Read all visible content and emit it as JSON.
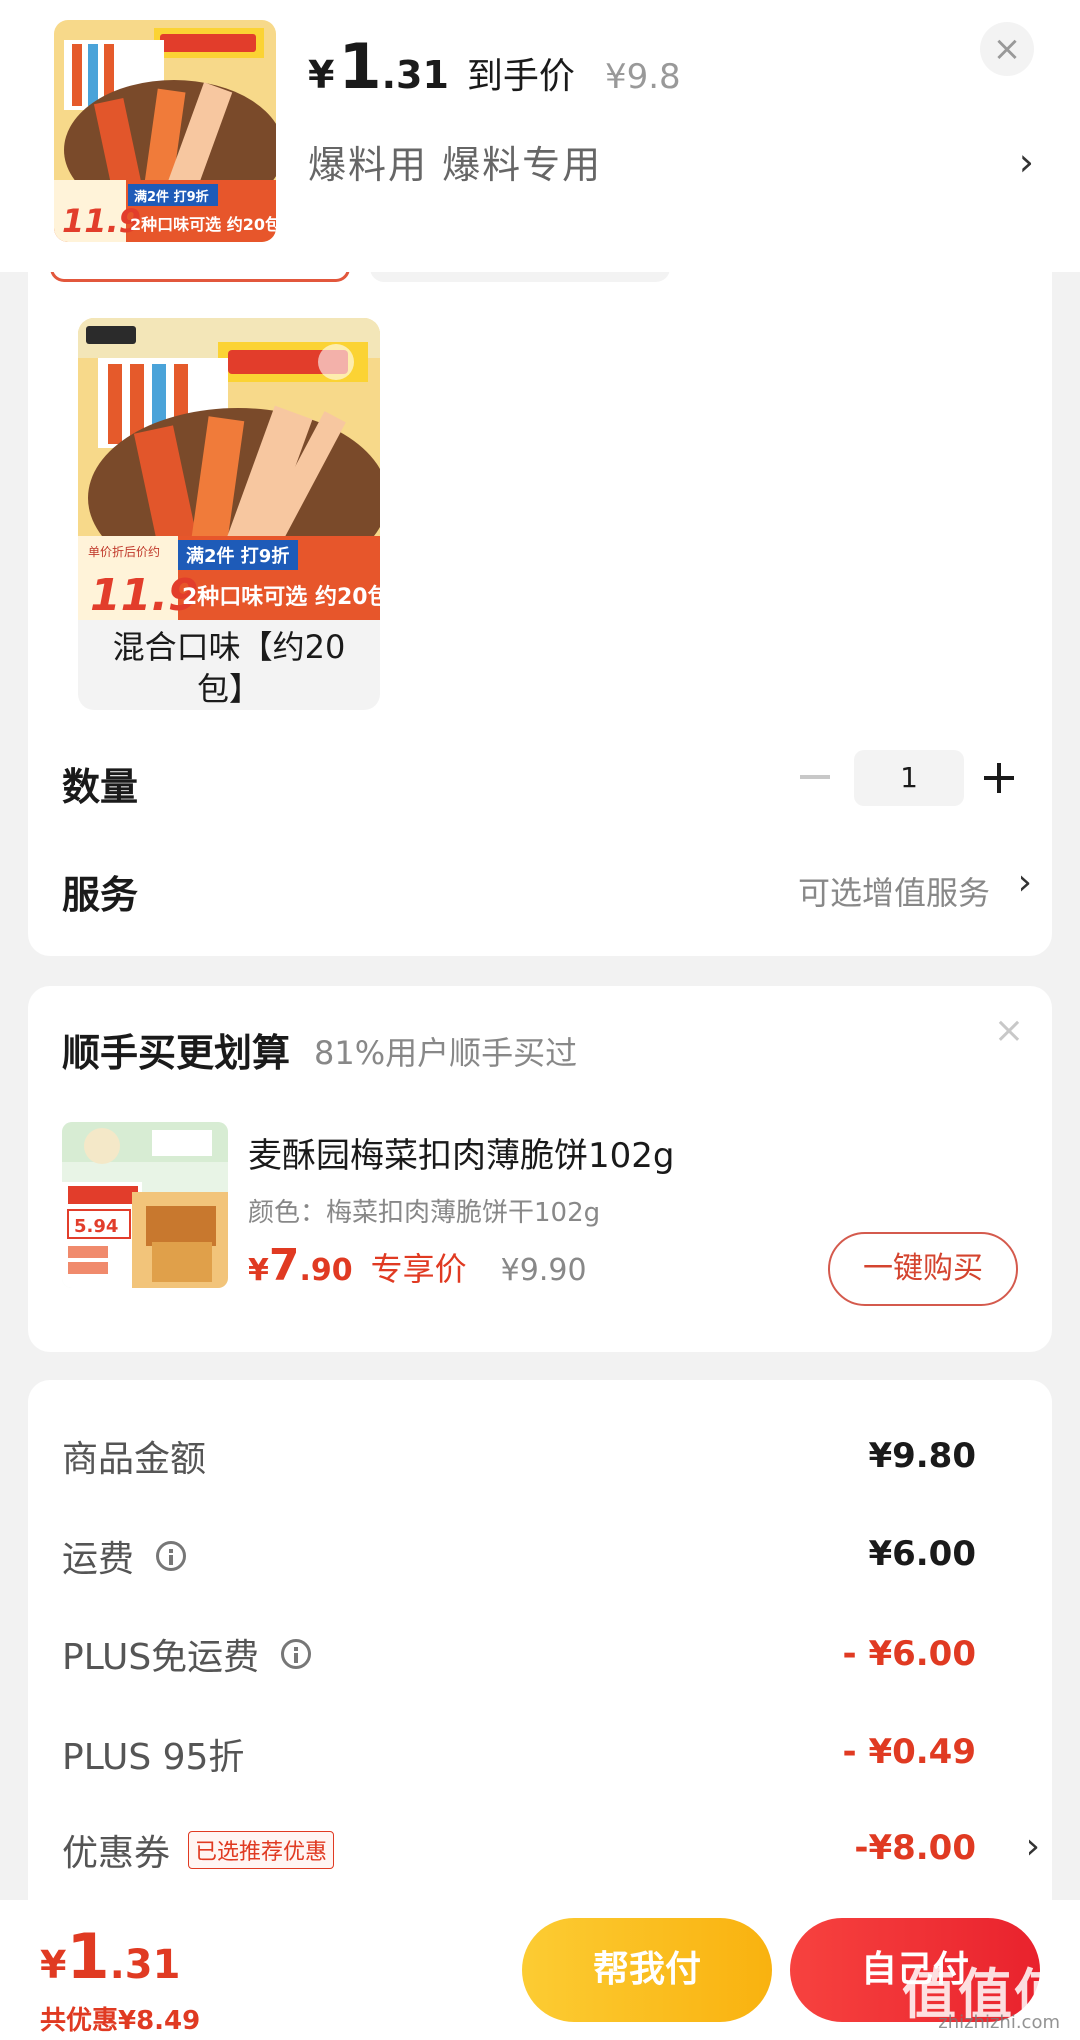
{
  "header": {
    "price_symbol": "¥",
    "price_int": "1",
    "price_dec": ".31",
    "price_tag": "到手价",
    "price_original": "¥9.8",
    "spec_text": "爆料用  爆料专用",
    "spec_chevron": "›",
    "close_glyph": "×"
  },
  "options": [
    {
      "label": "混合口味【约20包】"
    }
  ],
  "quantity": {
    "label": "数量",
    "value": "1"
  },
  "service": {
    "label": "服务",
    "value": "可选增值服务",
    "chevron": "›"
  },
  "addon": {
    "title": "顺手买更划算",
    "subtitle": "81%用户顺手买过",
    "close_glyph": "×",
    "product_name": "麦酥园梅菜扣肉薄脆饼102g",
    "variant": "颜色：梅菜扣肉薄脆饼干102g",
    "price_symbol": "¥",
    "price_int": "7",
    "price_dec": ".90",
    "price_tag": "专享价",
    "price_original": "¥9.90",
    "buy_label": "一键购买"
  },
  "totals": {
    "rows": [
      {
        "label": "商品金额",
        "value": "¥9.80"
      },
      {
        "label": "运费",
        "value": "¥6.00"
      },
      {
        "label": "PLUS免运费",
        "value": "- ¥6.00"
      },
      {
        "label": "PLUS 95折",
        "value": "- ¥0.49"
      },
      {
        "label": "优惠券",
        "value": "-¥8.00",
        "badge": "已选推荐优惠"
      }
    ],
    "coupon_chevron": "›"
  },
  "bottom": {
    "price_symbol": "¥",
    "price_int": "1",
    "price_dec": ".31",
    "savings": "共优惠¥8.49",
    "help_pay_label": "帮我付",
    "self_pay_label": "自己付",
    "watermark": "值值值",
    "watermark_url": "zhizhizhi.com"
  },
  "colors": {
    "accent_red": "#e03a22",
    "help_pay_yellow": "#f9b20f",
    "self_pay_red": "#e9222d"
  }
}
